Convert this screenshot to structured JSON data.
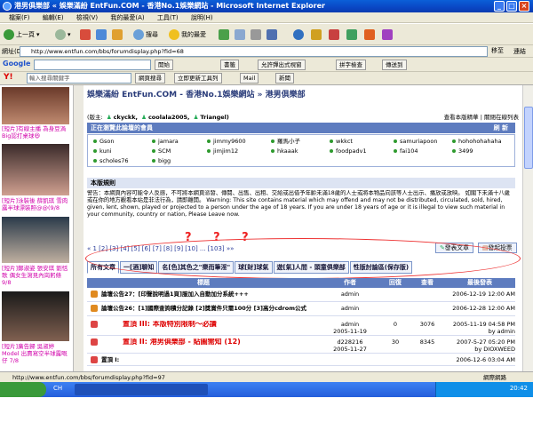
{
  "window": {
    "title": "港男俱樂部 « 娛樂滿紛 EntFun.COM - 香港No.1娛樂網站 - Microsoft Internet Explorer"
  },
  "menu": [
    "檔案(F)",
    "編輯(E)",
    "檢視(V)",
    "我的最愛(A)",
    "工具(T)",
    "說明(H)"
  ],
  "toolbar": {
    "back": "上一頁",
    "search": "搜尋",
    "favorites": "我的最愛"
  },
  "address": {
    "label": "網址(D)",
    "url": "http://www.entfun.com/bbs/forumdisplay.php?fid=68",
    "go": "移至",
    "links": "連結"
  },
  "google": {
    "brand": "Google",
    "start": "開始",
    "bookmarks": "書籤",
    "popups": "允許彈出式視窗",
    "spell": "拼字檢查",
    "send": "傳送到"
  },
  "yahoo": {
    "input_placeholder": "輸入搜尋關鍵字",
    "search_btn": "網頁搜尋",
    "update_btn": "立即更新工具列",
    "mail": "Mail",
    "news": "新聞"
  },
  "sidebar": [
    {
      "caption": "[短片]有線主播 為身豆渦Big認打桌球😆"
    },
    {
      "caption": "[短片]泳裝後 薛凱琪 雪肉露半球漂裝照@@(9/8"
    },
    {
      "caption": "[短片]鄭淑姿 張安琪 劉恬歌 偶女生瀉見內崗躬條 9/8"
    },
    {
      "caption": "[短片]廣告歸 吳淑婷Model 出賣寫空半球露嘅仔 7/8"
    }
  ],
  "forum": {
    "title": "娛樂滿紛 EntFun.COM - 香港No.1娛樂網站 » 港男俱樂部",
    "moderators_label": "(版主:",
    "moderators": [
      "ckyckk,",
      "coolala2005,",
      "Triangel)"
    ],
    "mod_links": "查看本版精華 | 關閉在線列表",
    "online_header": "正在瀏覽此論壇的會員",
    "refresh": "刷 新",
    "online": [
      [
        "Gson",
        "jamara",
        "jimmy9600",
        "羅馬小子",
        "wkkct",
        "samuriapoon",
        "hohohohahaha"
      ],
      [
        "kuni",
        "SCM",
        "jimjim12",
        "hkaaak",
        "foodpadv1",
        "fai104",
        "3499"
      ],
      [
        "scholes76",
        "bigg",
        "",
        "",
        "",
        "",
        ""
      ]
    ],
    "rules_header": "本版規則",
    "rules_text": "警告：本網頁內容可能令人反感，不可將本網頁派發、傳閱、出售、出租、交給或出借予年齡未滿18歲的人士或將本物品向該等人士出示、播放或放映。 如閣下未滿十八歲或在你的地方觀看本站是非法行為，請即離開。 Warning: This site contains material which may offend and may not be distributed, circulated, sold, hired, given, lent, shown, played or projected to a person under the age of 18 years. If you are under 18 years of age or it is illegal to view such material in your community, country or nation, Please Leave now.",
    "pager": "« 1 [2] [3] [4] [5] [6] [7] [8] [9] [10] ... [103] »»",
    "annotation": "? ? ?",
    "new_topic": "發表文章",
    "new_poll": "發起投票",
    "tabs": [
      "所有文章",
      "一[酒]聊知",
      "名[色]其色之\"樂而筆淫\"",
      "球[財]球氣",
      "遊[氣]人間 - 頭童俱樂部",
      "性版討論區(保存版)"
    ],
    "columns": {
      "title": "標題",
      "author": "作者",
      "replies": "回復",
      "views": "查看",
      "last": "最後發表"
    },
    "rows": [
      {
        "title": "論壇公告27：[印聲說明過1頁]服加入自動加分系統+++",
        "author": "admin",
        "replies": "",
        "views": "",
        "last": "2006-12-19 12:00 AM",
        "last_by": "",
        "red": false
      },
      {
        "title": "論壇公告26：[1]國際查詢積分記錄 [2]獎賞件只需100分 [3]高分cdrom公式",
        "author": "admin",
        "replies": "",
        "views": "",
        "last": "2006-12-28 12:00 AM",
        "last_by": "",
        "red": false
      },
      {
        "title": "置頂 III: 本版特別限制～必讀",
        "author": "admin",
        "date": "2005-11-19",
        "replies": "0",
        "views": "3076",
        "last": "2005-11-19 04:58 PM",
        "last_by": "by admin",
        "red": true
      },
      {
        "title": "置頂 II: 港男俱樂部 - 貼圖需知 (12)",
        "author": "d228216",
        "date": "2005-11-27",
        "replies": "30",
        "views": "8345",
        "last": "2007-5-27 05:20 PM",
        "last_by": "by DIOXWEED",
        "red": true
      },
      {
        "title": "置頂 I:",
        "author": "",
        "date": "",
        "replies": "",
        "views": "",
        "last": "2006-12-6 03:04 AM",
        "last_by": "",
        "red": false
      }
    ]
  },
  "status": {
    "url": "http://www.entfun.com/bbs/forumdisplay.php?fid=97",
    "zone": "網際網路"
  },
  "taskbar": {
    "lang": "CH",
    "clock": "20:42"
  },
  "colors": {
    "header_blue": "#5e7cbf",
    "annotation_red": "#e33",
    "title_blue": "#0a46c4"
  }
}
